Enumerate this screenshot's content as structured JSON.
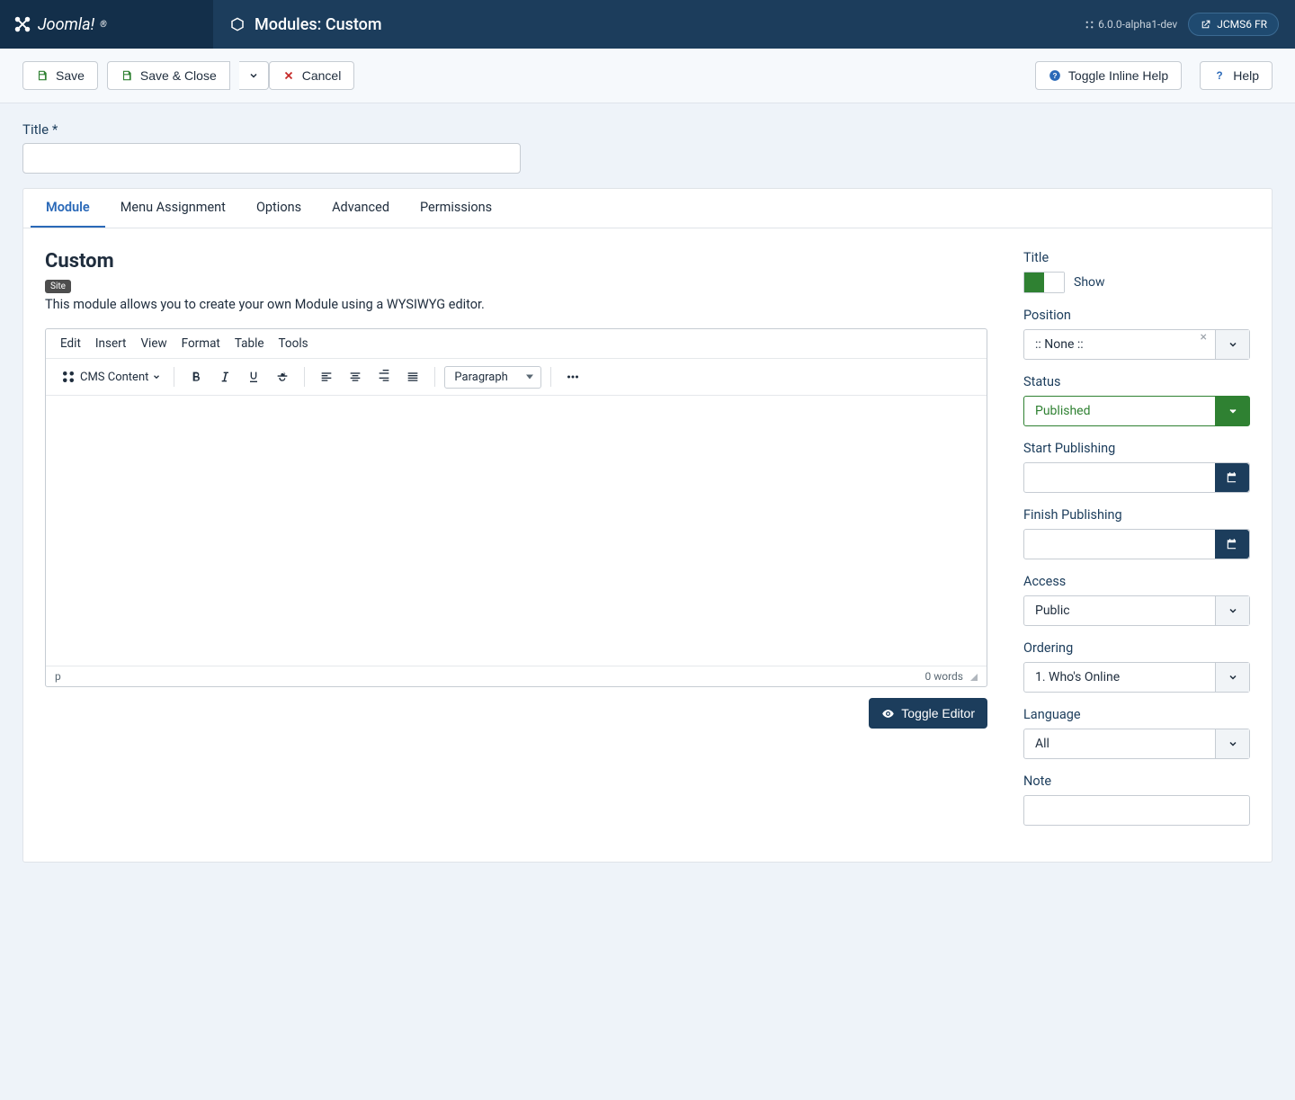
{
  "header": {
    "brand": "Joomla!",
    "page_title": "Modules: Custom",
    "version": "6.0.0-alpha1-dev",
    "user": "JCMS6 FR"
  },
  "toolbar": {
    "save": "Save",
    "save_close": "Save & Close",
    "cancel": "Cancel",
    "toggle_help": "Toggle Inline Help",
    "help": "Help"
  },
  "title_field": {
    "label": "Title *",
    "value": ""
  },
  "tabs": [
    "Module",
    "Menu Assignment",
    "Options",
    "Advanced",
    "Permissions"
  ],
  "module": {
    "heading": "Custom",
    "badge": "Site",
    "description": "This module allows you to create your own Module using a WYSIWYG editor."
  },
  "editor": {
    "menus": [
      "Edit",
      "Insert",
      "View",
      "Format",
      "Table",
      "Tools"
    ],
    "cms_content": "CMS Content",
    "paragraph": "Paragraph",
    "path": "p",
    "words": "0 words"
  },
  "toggle_editor_btn": "Toggle Editor",
  "sidebar": {
    "title": {
      "label": "Title",
      "switch_label": "Show"
    },
    "position": {
      "label": "Position",
      "value": ":: None ::"
    },
    "status": {
      "label": "Status",
      "value": "Published"
    },
    "start_publishing": {
      "label": "Start Publishing",
      "value": ""
    },
    "finish_publishing": {
      "label": "Finish Publishing",
      "value": ""
    },
    "access": {
      "label": "Access",
      "value": "Public"
    },
    "ordering": {
      "label": "Ordering",
      "value": "1. Who's Online"
    },
    "language": {
      "label": "Language",
      "value": "All"
    },
    "note": {
      "label": "Note",
      "value": ""
    }
  }
}
